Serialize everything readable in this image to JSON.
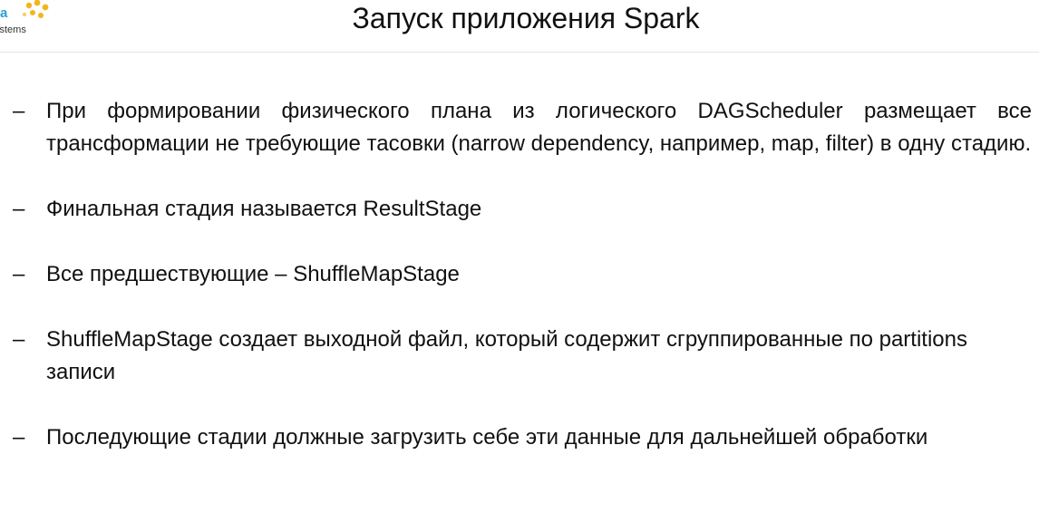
{
  "logo": {
    "letter": "a",
    "company_fragment": "ystems",
    "dot_color": "#f2b51b",
    "accent_color": "#2a9fd8"
  },
  "slide": {
    "title": "Запуск приложения Spark",
    "bullet_marker": "–",
    "bullets": [
      "При формировании физического плана из логического DAGScheduler размещает все трансформации не требующие тасовки (narrow dependency, например, map, filter) в одну стадию.",
      "Финальная стадия называется ResultStage",
      "Все предшествующие – ShuffleMapStage",
      "ShuffleMapStage создает выходной файл, который содержит сгруппированные по partitions записи",
      "Последующие стадии должные загрузить себе эти данные для дальнейшей обработки"
    ]
  }
}
